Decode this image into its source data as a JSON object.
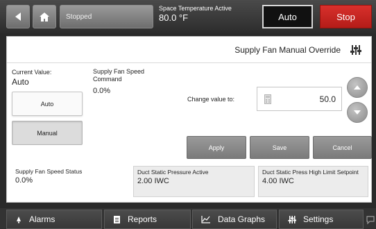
{
  "topbar": {
    "status": "Stopped",
    "temp_label": "Space Temperature Active",
    "temp_value": "80.0 °F",
    "auto_label": "Auto",
    "stop_label": "Stop"
  },
  "panel": {
    "title": "Supply Fan Manual Override",
    "current_value_label": "Current Value:",
    "current_value": "Auto",
    "auto_button": "Auto",
    "manual_button": "Manual",
    "command_label": "Supply Fan Speed Command",
    "command_value": "0.0%",
    "change_label": "Change value to:",
    "change_value": "50.0",
    "apply_button": "Apply",
    "save_button": "Save",
    "cancel_button": "Cancel"
  },
  "status": [
    {
      "label": "Supply Fan Speed Status",
      "value": "0.0%"
    },
    {
      "label": "Duct Static Pressure Active",
      "value": "2.00 IWC"
    },
    {
      "label": "Duct Static Press High Limit Setpoint",
      "value": "4.00 IWC"
    }
  ],
  "nav": {
    "alarms": "Alarms",
    "reports": "Reports",
    "graphs": "Data Graphs",
    "settings": "Settings"
  },
  "icons": {
    "back": "back-arrow-icon",
    "home": "home-icon",
    "settings": "sliders-icon",
    "calculator": "calculator-icon",
    "up": "arrow-up-icon",
    "down": "arrow-down-icon",
    "alarm": "bell-icon",
    "report": "document-icon",
    "graph": "chart-icon",
    "chat": "chat-icon"
  },
  "colors": {
    "stop": "#c8241f",
    "auto_bg": "#111111",
    "panel_bg": "#ffffff",
    "chrome": "#2c2c2c"
  }
}
